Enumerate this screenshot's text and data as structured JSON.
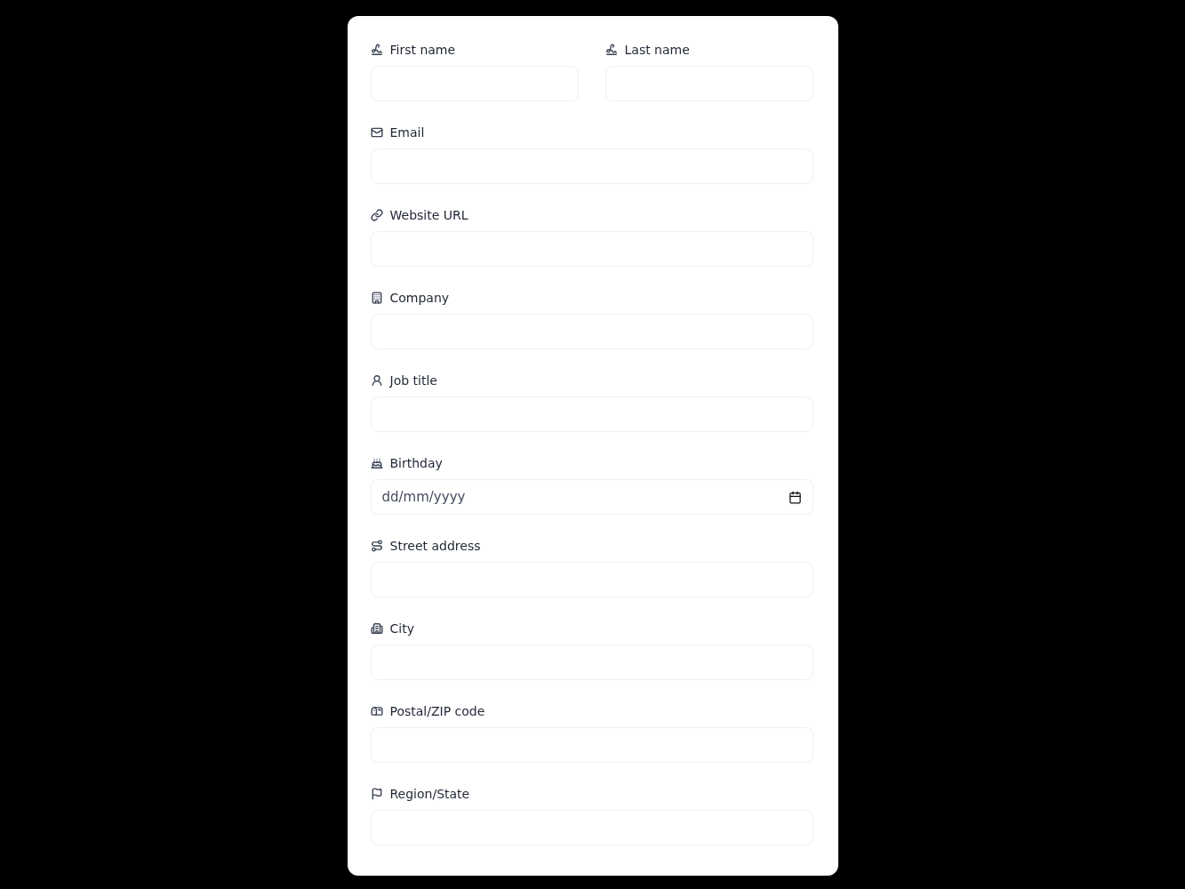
{
  "rows": [
    {
      "fields": [
        {
          "label": "First name",
          "kind": "text"
        },
        {
          "label": "Last name",
          "kind": "text"
        }
      ]
    },
    {
      "fields": [
        {
          "label": "Email",
          "kind": "text"
        }
      ]
    },
    {
      "fields": [
        {
          "label": "Website URL",
          "kind": "text"
        }
      ]
    },
    {
      "fields": [
        {
          "label": "Company",
          "kind": "text"
        }
      ]
    },
    {
      "fields": [
        {
          "label": "Job title",
          "kind": "text"
        }
      ]
    },
    {
      "fields": [
        {
          "label": "Birthday",
          "kind": "date",
          "placeholder": "dd/mm/yyyy"
        }
      ]
    },
    {
      "fields": [
        {
          "label": "Street address",
          "kind": "text"
        }
      ]
    },
    {
      "fields": [
        {
          "label": "City",
          "kind": "text"
        }
      ]
    },
    {
      "fields": [
        {
          "label": "Postal/ZIP code",
          "kind": "text"
        }
      ]
    },
    {
      "fields": [
        {
          "label": "Region/State",
          "kind": "text"
        }
      ]
    }
  ]
}
